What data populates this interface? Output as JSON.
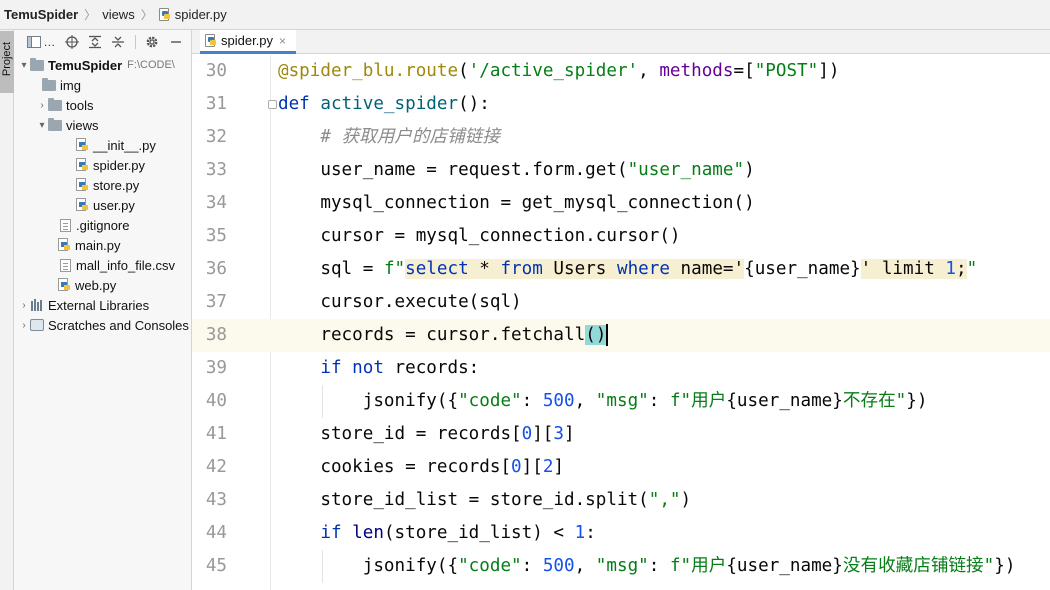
{
  "breadcrumb": {
    "project": "TemuSpider",
    "folder": "views",
    "file": "spider.py"
  },
  "toolwindow": {
    "tab_label": "Project"
  },
  "project_tree": {
    "root_name": "TemuSpider",
    "root_path": "F:\\CODE\\",
    "items": [
      {
        "name": "img",
        "type": "folder"
      },
      {
        "name": "tools",
        "type": "folder"
      },
      {
        "name": "views",
        "type": "folder"
      },
      {
        "name": "__init__.py",
        "type": "py"
      },
      {
        "name": "spider.py",
        "type": "py"
      },
      {
        "name": "store.py",
        "type": "py"
      },
      {
        "name": "user.py",
        "type": "py"
      },
      {
        "name": ".gitignore",
        "type": "file"
      },
      {
        "name": "main.py",
        "type": "py"
      },
      {
        "name": "mall_info_file.csv",
        "type": "file"
      },
      {
        "name": "web.py",
        "type": "py"
      },
      {
        "name": "External Libraries",
        "type": "lib"
      },
      {
        "name": "Scratches and Consoles",
        "type": "scratch"
      }
    ]
  },
  "editor": {
    "tab_label": "spider.py",
    "line_numbers": [
      "30",
      "31",
      "32",
      "33",
      "34",
      "35",
      "36",
      "37",
      "38",
      "39",
      "40",
      "41",
      "42",
      "43",
      "44",
      "45"
    ],
    "current_line": "38"
  }
}
